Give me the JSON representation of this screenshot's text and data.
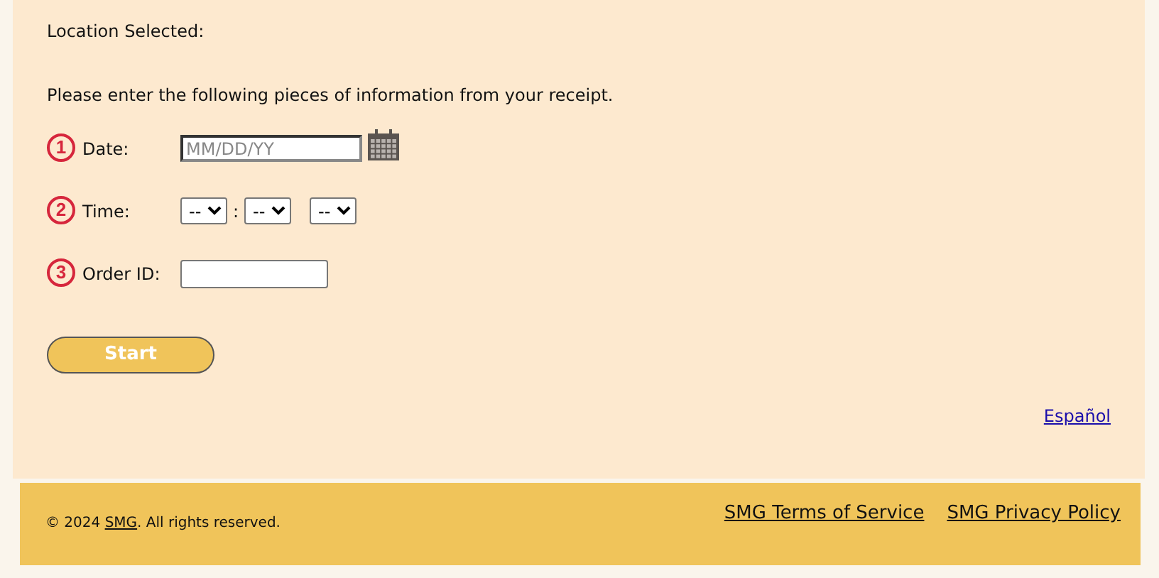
{
  "location_label": "Location Selected:",
  "instructions": "Please enter the following pieces of information from your receipt.",
  "steps": [
    {
      "number": "1",
      "label": "Date:",
      "kind": "date",
      "placeholder": "MM/DD/YY"
    },
    {
      "number": "2",
      "label": "Time:",
      "kind": "time",
      "selects": [
        "--",
        "--",
        "--"
      ],
      "separator": ":"
    },
    {
      "number": "3",
      "label": "Order ID:",
      "kind": "text"
    }
  ],
  "start_button": "Start",
  "language_link": "Español",
  "footer": {
    "copyright_before": "© 2024 ",
    "copyright_link": "SMG",
    "copyright_after": ". All rights reserved.",
    "links": [
      "SMG Terms of Service",
      "SMG Privacy Policy"
    ]
  }
}
